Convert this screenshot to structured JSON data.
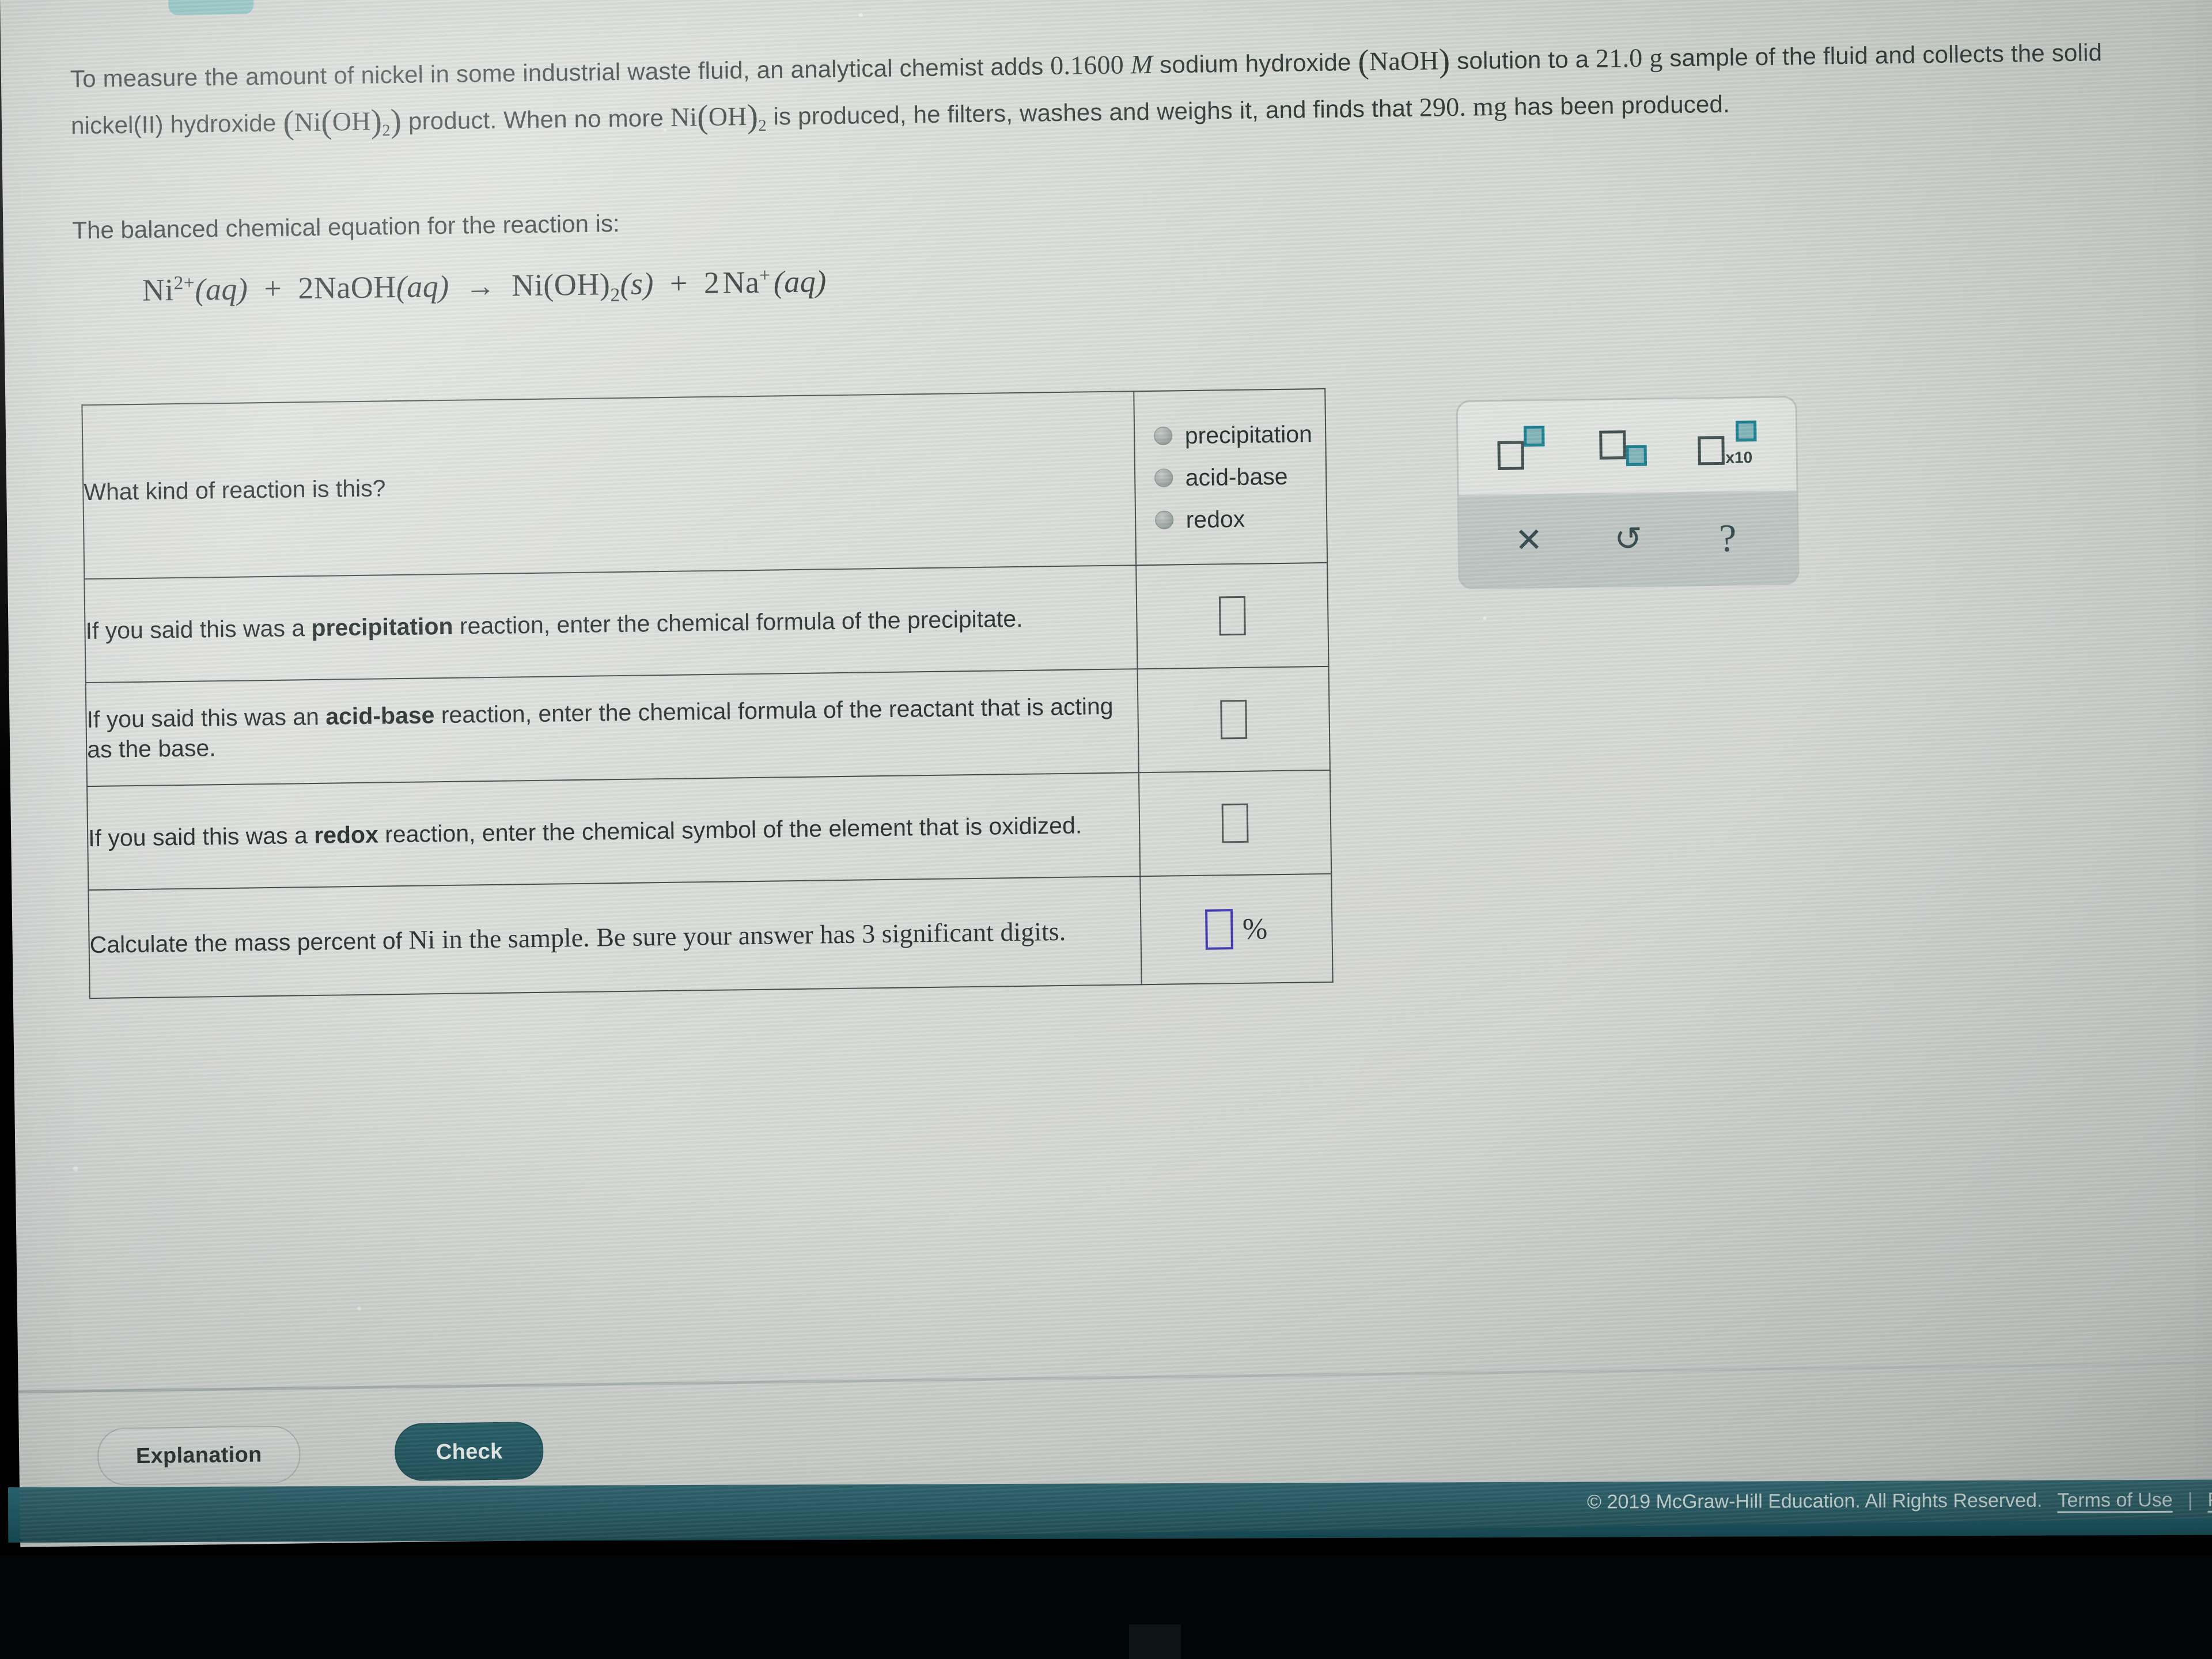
{
  "top_tab": {
    "icon": "chevron-down-icon"
  },
  "statement": {
    "line1_a": "To measure the amount of nickel in some industrial waste fluid, an analytical chemist adds ",
    "molarity": "0.1600",
    "molarity_unit": "M",
    "line1_b": " sodium hydroxide ",
    "naoh": "(NaOH)",
    "line1_c": " solution to a ",
    "mass": "21.0",
    "mass_unit": "g",
    "line1_d": " sample of the fluid and collects the solid nickel(II) hydroxide ",
    "product_formula": "(Ni(OH)2)",
    "line2_a": " product. When no more ",
    "product_short": "Ni(OH)2",
    "line2_b": " is produced, he filters, washes and weighs it, and finds that ",
    "yield": "290.",
    "yield_unit": "mg",
    "line3": " has been produced.",
    "balanced_intro": "The balanced chemical equation for the reaction is:"
  },
  "equation": {
    "reactant1": "Ni2+(aq)",
    "plus1": "+",
    "reactant2": "2NaOH(aq)",
    "arrow": "→",
    "product1": "Ni(OH)2(s)",
    "plus2": "+",
    "product2": "2 Na+ (aq)"
  },
  "table": {
    "rows": [
      {
        "question": "What kind of reaction is this?",
        "answer_type": "radio",
        "options": [
          "precipitation",
          "acid-base",
          "redox"
        ],
        "selected": null
      },
      {
        "question_pre": "If you said this was a ",
        "question_bold": "precipitation",
        "question_post": " reaction, enter the chemical formula of the precipitate.",
        "answer_type": "input",
        "value": "",
        "suffix": ""
      },
      {
        "question_pre": "If you said this was an ",
        "question_bold": "acid-base",
        "question_post": " reaction, enter the chemical formula of the reactant that is acting as the base.",
        "answer_type": "input",
        "value": "",
        "suffix": ""
      },
      {
        "question_pre": "If you said this was a ",
        "question_bold": "redox",
        "question_post": " reaction, enter the chemical symbol of the element that is oxidized.",
        "answer_type": "input",
        "value": "",
        "suffix": ""
      },
      {
        "question_pre": "Calculate the mass percent of ",
        "question_bold": "",
        "question_post": "Ni in the sample. Be sure your answer has 3 significant digits.",
        "answer_type": "input-focused",
        "value": "",
        "suffix": "%"
      }
    ]
  },
  "toolbar": {
    "superscript_icon": "superscript-icon",
    "subscript_icon": "subscript-icon",
    "scientific_notation_icon": "times-ten-icon",
    "scientific_notation_label": "x10",
    "clear_icon": "✕",
    "undo_icon": "↺",
    "help_icon": "?"
  },
  "buttons": {
    "explanation": "Explanation",
    "check": "Check"
  },
  "footer": {
    "copyright": "© 2019 McGraw-Hill Education. All Rights Reserved.",
    "terms": "Terms of Use",
    "separator": "|",
    "privacy": "Pri"
  },
  "colors": {
    "teal_tab": "#85c4c5",
    "check_button": "#1f5a65",
    "footer_bar": "#1d525d",
    "focused_input_border": "#3a2fb0",
    "toolbar_accent": "#157c8c",
    "page_bg": "#d9dcd7"
  }
}
